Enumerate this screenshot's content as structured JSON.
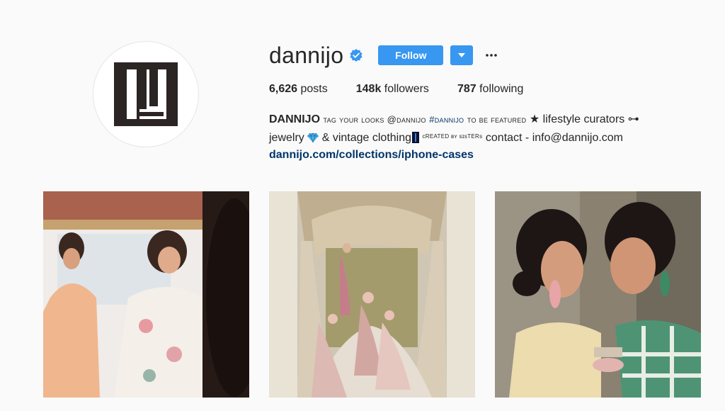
{
  "profile": {
    "username": "dannijo",
    "follow_label": "Follow",
    "more_label": "•••",
    "stats": {
      "posts_count": "6,626",
      "posts_label": "posts",
      "followers_count": "148k",
      "followers_label": "followers",
      "following_count": "787",
      "following_label": "following"
    },
    "bio": {
      "name": "DANNIJO",
      "part1": "tag your looks @dannijo",
      "hashtag": "#dannijo",
      "part2": "to be featured",
      "star": "★",
      "part3": "lifestyle curators ⊶",
      "line2a": "jewelry",
      "line2b": "& vintage clothing",
      "tiny": "ᴄREATED ʙʏ sɪsTERs",
      "contact": "contact - info@dannijo.com"
    },
    "link": "dannijo.com/collections/iphone-cases"
  },
  "posts": [
    {
      "name": "post-1"
    },
    {
      "name": "post-2"
    },
    {
      "name": "post-3"
    }
  ],
  "colors": {
    "accent": "#3897f0",
    "link": "#003569",
    "verified": "#3897f0"
  }
}
